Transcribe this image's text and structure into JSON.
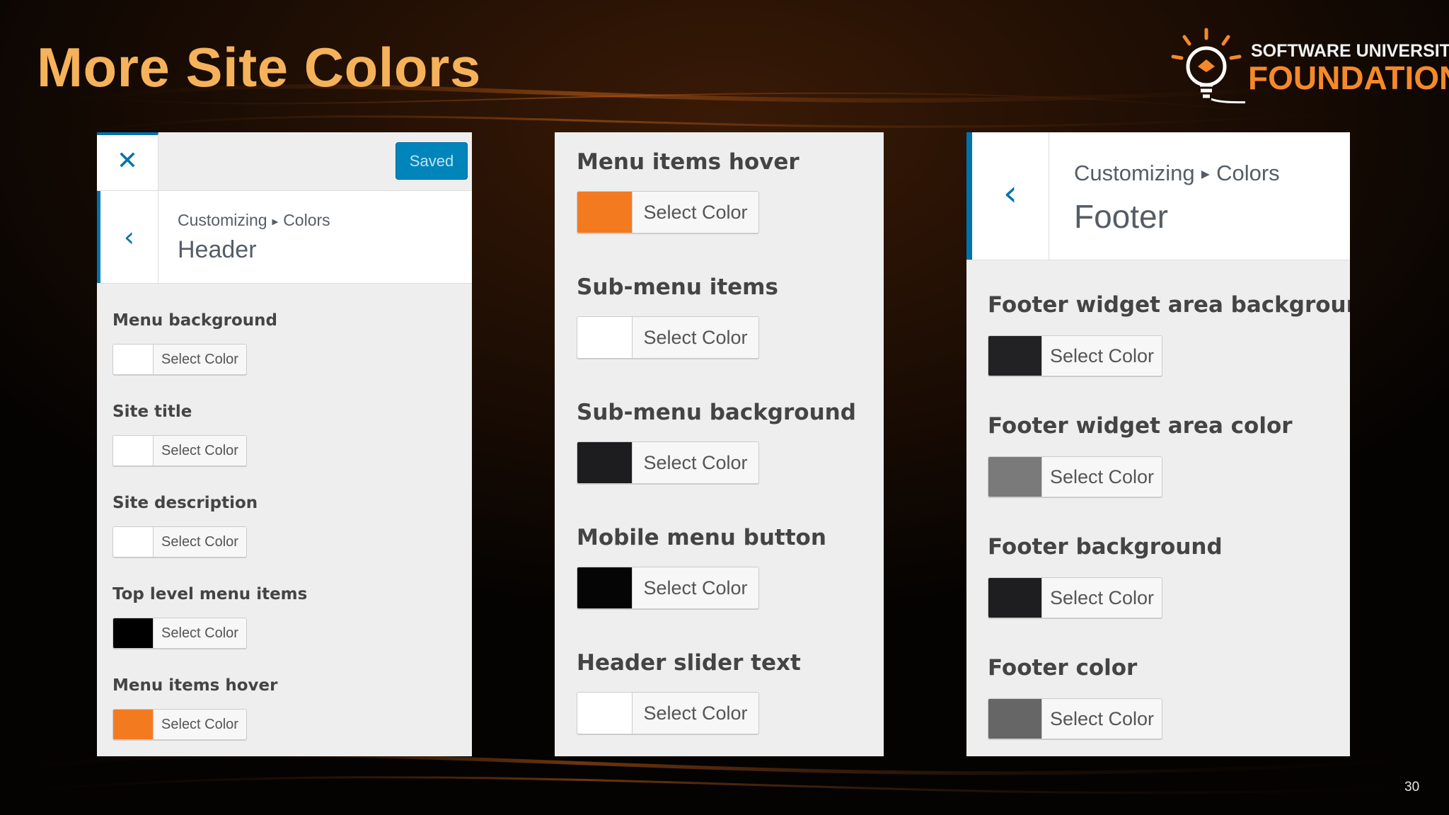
{
  "slide": {
    "title": "More Site Colors",
    "page_number": "30",
    "logo": {
      "line1": "SOFTWARE UNIVERSITY",
      "line2": "FOUNDATION"
    }
  },
  "colors": {
    "title": "#f6b25a",
    "accent_blue": "#0073aa",
    "saved_button": "#0085ba",
    "panel_bg": "#eeeeee",
    "logo_orange": "#f5892a"
  },
  "panels": {
    "left": {
      "close_icon": "close-icon",
      "save_button_label": "Saved",
      "back_icon": "chevron-left-icon",
      "breadcrumb": {
        "parent": "Customizing",
        "current": "Colors"
      },
      "section_title": "Header",
      "fields": [
        {
          "label": "Menu background",
          "button": "Select Color",
          "color": "#ffffff"
        },
        {
          "label": "Site title",
          "button": "Select Color",
          "color": "#ffffff"
        },
        {
          "label": "Site description",
          "button": "Select Color",
          "color": "#ffffff"
        },
        {
          "label": "Top level menu items",
          "button": "Select Color",
          "color": "#000000"
        },
        {
          "label": "Menu items hover",
          "button": "Select Color",
          "color": "#f47a20"
        }
      ]
    },
    "middle": {
      "fields": [
        {
          "label": "Menu items hover",
          "button": "Select Color",
          "color": "#f47a20"
        },
        {
          "label": "Sub-menu items",
          "button": "Select Color",
          "color": "#ffffff"
        },
        {
          "label": "Sub-menu background",
          "button": "Select Color",
          "color": "#1d1d1f"
        },
        {
          "label": "Mobile menu button",
          "button": "Select Color",
          "color": "#050505"
        },
        {
          "label": "Header slider text",
          "button": "Select Color",
          "color": "#ffffff"
        }
      ]
    },
    "right": {
      "back_icon": "chevron-left-icon",
      "breadcrumb": {
        "parent": "Customizing",
        "current": "Colors"
      },
      "section_title": "Footer",
      "fields": [
        {
          "label": "Footer widget area background",
          "button": "Select Color",
          "color": "#222224"
        },
        {
          "label": "Footer widget area color",
          "button": "Select Color",
          "color": "#7a7a7a"
        },
        {
          "label": "Footer background",
          "button": "Select Color",
          "color": "#1e1e20"
        },
        {
          "label": "Footer color",
          "button": "Select Color",
          "color": "#666666"
        }
      ]
    }
  }
}
